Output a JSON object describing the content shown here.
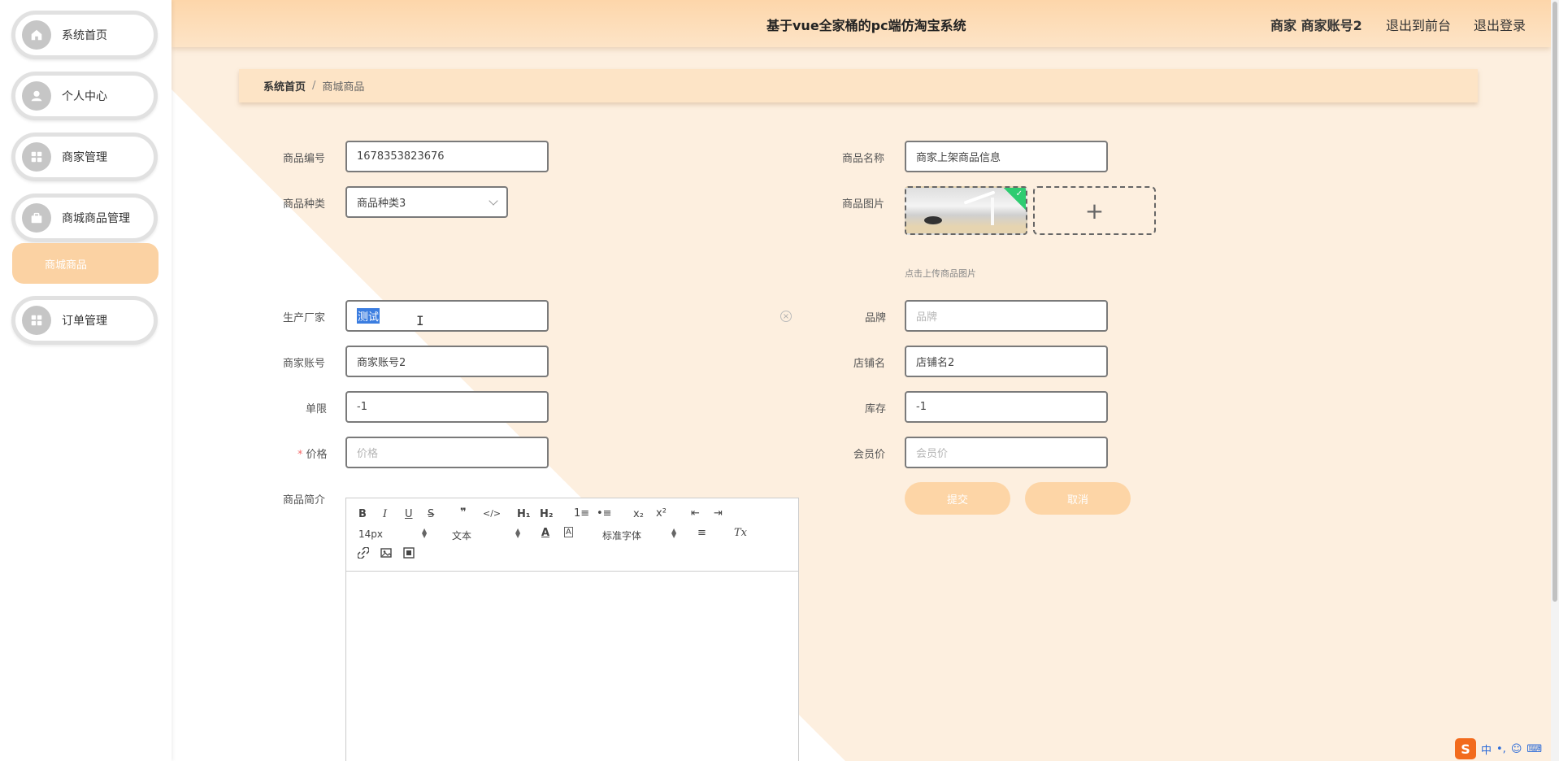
{
  "colors": {
    "accent": "#fbd2a3",
    "header": "#fdd6aa",
    "background": "#fdf0e0",
    "required": "#f56c6c"
  },
  "sidebar": {
    "items": [
      {
        "label": "系统首页",
        "icon": "home-icon"
      },
      {
        "label": "个人中心",
        "icon": "user-icon"
      },
      {
        "label": "商家管理",
        "icon": "grid-icon"
      },
      {
        "label": "商城商品管理",
        "icon": "briefcase-icon"
      },
      {
        "label": "订单管理",
        "icon": "grid-icon"
      }
    ],
    "sub_item": "商城商品"
  },
  "header": {
    "title": "基于vue全家桶的pc端仿淘宝系统",
    "user": "商家 商家账号2",
    "to_front": "退出到前台",
    "logout": "退出登录"
  },
  "breadcrumb": {
    "home": "系统首页",
    "separator": "/",
    "current": "商城商品"
  },
  "form": {
    "product_no": {
      "label": "商品编号",
      "value": "1678353823676"
    },
    "product_name": {
      "label": "商品名称",
      "value": "商家上架商品信息"
    },
    "category": {
      "label": "商品种类",
      "value": "商品种类3"
    },
    "image": {
      "label": "商品图片",
      "hint": "点击上传商品图片"
    },
    "manufacturer": {
      "label": "生产厂家",
      "value": "测试"
    },
    "brand": {
      "label": "品牌",
      "placeholder": "品牌"
    },
    "merchant_account": {
      "label": "商家账号",
      "value": "商家账号2"
    },
    "shop_name": {
      "label": "店铺名",
      "value": "店铺名2"
    },
    "limit": {
      "label": "单限",
      "value": "-1"
    },
    "stock": {
      "label": "库存",
      "value": "-1"
    },
    "price": {
      "label": "价格",
      "required_mark": "*",
      "placeholder": "价格"
    },
    "member_price": {
      "label": "会员价",
      "placeholder": "会员价"
    },
    "description": {
      "label": "商品简介"
    }
  },
  "buttons": {
    "submit": "提交",
    "cancel": "取消"
  },
  "editor": {
    "bold": "B",
    "italic": "I",
    "underline": "U",
    "strike": "S",
    "quote": "❞",
    "code": "</>",
    "h1": "H₁",
    "h2": "H₂",
    "ordered_list": "1≡",
    "bullet_list": "•≡",
    "sub": "x₂",
    "sup": "x²",
    "outdent": "⇤",
    "indent": "⇥",
    "size": "14px",
    "header": "文本",
    "color": "A",
    "background": "A",
    "font": "标准字体",
    "align": "≡",
    "clean": "Tx"
  },
  "ime": {
    "logo": "S",
    "lang": "中"
  }
}
